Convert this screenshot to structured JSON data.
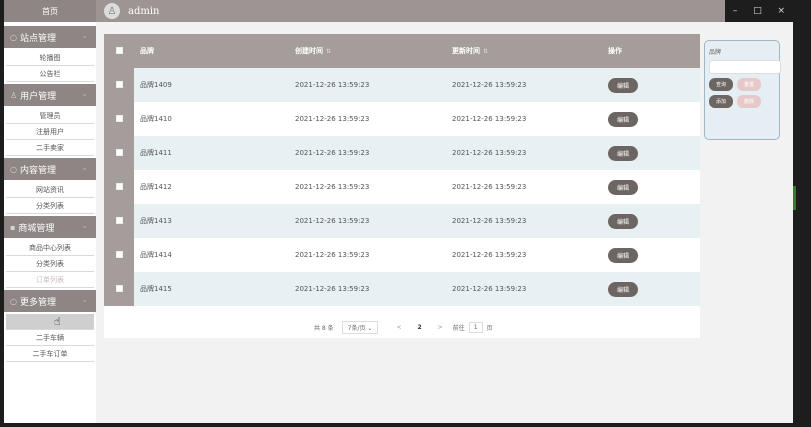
{
  "sidebar": {
    "home": "首页",
    "groups": [
      {
        "title": "站点管理",
        "items": [
          "轮播图",
          "公告栏"
        ]
      },
      {
        "title": "用户管理",
        "items": [
          "管理员",
          "注册用户",
          "二手卖家"
        ]
      },
      {
        "title": "内容管理",
        "items": [
          "网站资讯",
          "分类列表"
        ]
      },
      {
        "title": "商城管理",
        "items": [
          "商品中心列表",
          "分类列表",
          "订单列表"
        ]
      },
      {
        "title": "更多管理",
        "items": [
          "",
          "二手车辆",
          "二手车订单"
        ]
      }
    ]
  },
  "header": {
    "username": "admin",
    "minimize": "–",
    "maximize": "□",
    "close": "×"
  },
  "table": {
    "columns": [
      "品牌",
      "创建时间",
      "更新时间",
      "操作"
    ],
    "rows": [
      {
        "brand": "品牌1409",
        "created": "2021-12-26 13:59:23",
        "updated": "2021-12-26 13:59:23",
        "action": "编辑"
      },
      {
        "brand": "品牌1410",
        "created": "2021-12-26 13:59:23",
        "updated": "2021-12-26 13:59:23",
        "action": "编辑"
      },
      {
        "brand": "品牌1411",
        "created": "2021-12-26 13:59:23",
        "updated": "2021-12-26 13:59:23",
        "action": "编辑"
      },
      {
        "brand": "品牌1412",
        "created": "2021-12-26 13:59:23",
        "updated": "2021-12-26 13:59:23",
        "action": "编辑"
      },
      {
        "brand": "品牌1413",
        "created": "2021-12-26 13:59:23",
        "updated": "2021-12-26 13:59:23",
        "action": "编辑"
      },
      {
        "brand": "品牌1414",
        "created": "2021-12-26 13:59:23",
        "updated": "2021-12-26 13:59:23",
        "action": "编辑"
      },
      {
        "brand": "品牌1415",
        "created": "2021-12-26 13:59:23",
        "updated": "2021-12-26 13:59:23",
        "action": "编辑"
      }
    ]
  },
  "pager": {
    "total": "共 8 条",
    "page_size": "7条/页",
    "prev": "<",
    "current": "2",
    "next": ">",
    "goto_prefix": "前往",
    "goto_value": "1",
    "goto_suffix": "页"
  },
  "search": {
    "label": "品牌",
    "query_btn": "查询",
    "reset_btn": "重置",
    "add_btn": "添加",
    "delete_btn": "删除"
  }
}
